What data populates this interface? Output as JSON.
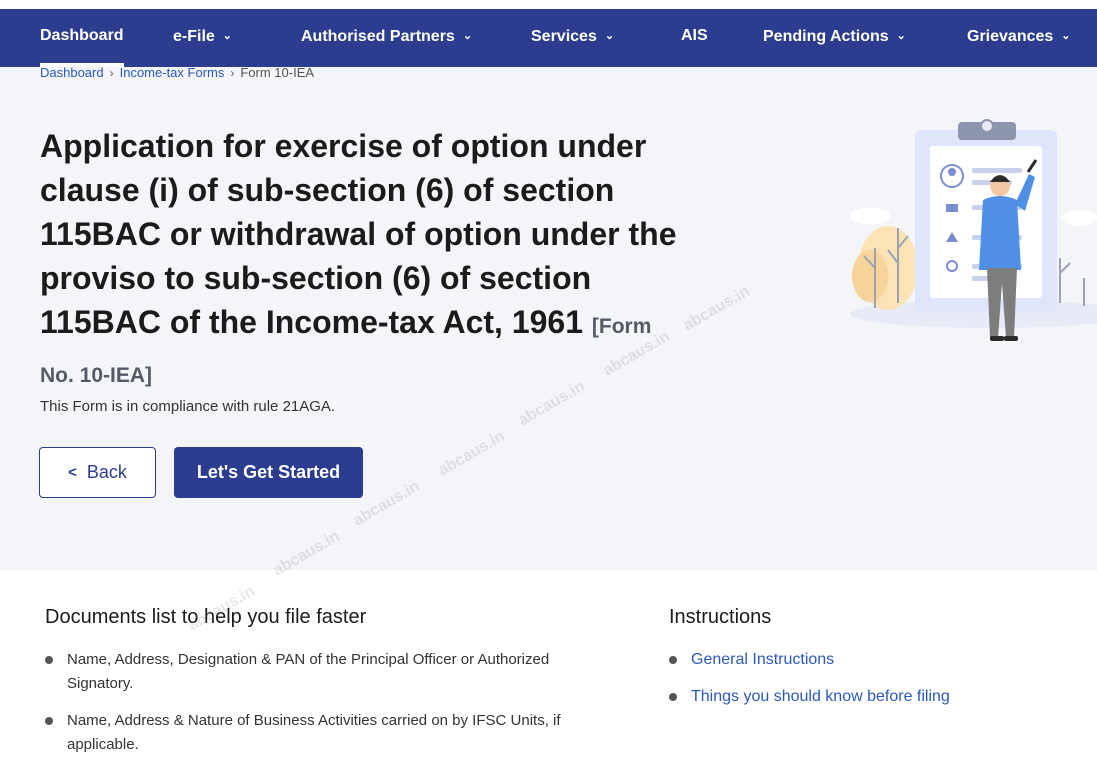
{
  "nav": {
    "items": [
      {
        "label": "Dashboard",
        "has_dropdown": false
      },
      {
        "label": "e-File",
        "has_dropdown": true
      },
      {
        "label": "Authorised Partners",
        "has_dropdown": true
      },
      {
        "label": "Services",
        "has_dropdown": true
      },
      {
        "label": "AIS",
        "has_dropdown": false
      },
      {
        "label": "Pending Actions",
        "has_dropdown": true
      },
      {
        "label": "Grievances",
        "has_dropdown": true
      }
    ]
  },
  "breadcrumb": {
    "items": [
      "Dashboard",
      "Income-tax Forms"
    ],
    "current": "Form 10-IEA"
  },
  "page": {
    "title": "Application for exercise of option under clause (i) of sub-section (6) of section 115BAC or withdrawal of option under the proviso to sub-section (6) of section 115BAC of the Income-tax Act, 1961",
    "title_suffix": "[Form No. 10-IEA]",
    "subtitle": "This Form is in compliance with rule 21AGA."
  },
  "buttons": {
    "back": "Back",
    "start": "Let's Get Started"
  },
  "documents": {
    "heading": "Documents list to help you file faster",
    "items": [
      "Name, Address, Designation & PAN of the Principal Officer or Authorized Signatory.",
      "Name, Address & Nature of Business Activities carried on by IFSC Units, if applicable."
    ]
  },
  "instructions": {
    "heading": "Instructions",
    "links": [
      "General Instructions",
      "Things you should know before filing"
    ]
  },
  "watermark": "abcaus.in",
  "colors": {
    "nav_bg": "#2c3d8f",
    "hero_bg": "#f4f5f9",
    "link": "#2a59b8",
    "primary_button": "#2c3d8f"
  }
}
